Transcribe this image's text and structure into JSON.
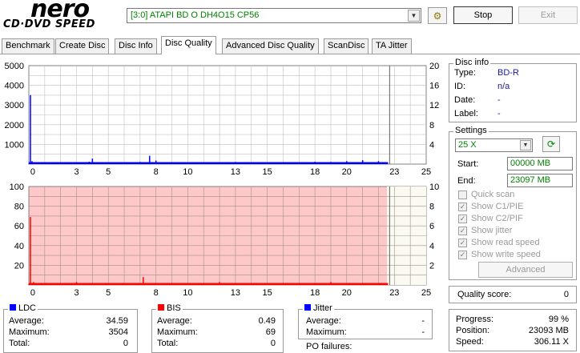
{
  "logo": {
    "main": "nero",
    "sub": "CD·DVD SPEED"
  },
  "drive": {
    "selected": "[3:0]  ATAPI BD  O  DH4O15 CP56"
  },
  "buttons": {
    "stop": "Stop",
    "exit": "Exit",
    "advanced": "Advanced"
  },
  "tabs": [
    {
      "label": "Benchmark"
    },
    {
      "label": "Create Disc"
    },
    {
      "label": "Disc Info"
    },
    {
      "label": "Disc Quality"
    },
    {
      "label": "Advanced Disc Quality"
    },
    {
      "label": "ScanDisc"
    },
    {
      "label": "TA Jitter"
    }
  ],
  "active_tab": "Disc Quality",
  "chart_data": [
    {
      "type": "line",
      "name": "LDC chart",
      "x_ticks": [
        "0",
        "3",
        "5",
        "8",
        "10",
        "13",
        "15",
        "18",
        "20",
        "23",
        "25"
      ],
      "y_left_ticks": [
        "5000",
        "4000",
        "3000",
        "2000",
        "1000"
      ],
      "y_right_ticks": [
        "20",
        "16",
        "12",
        "8",
        "4"
      ],
      "xlim": [
        0,
        25
      ],
      "ylim": [
        0,
        5000
      ],
      "series": [
        {
          "color": "#0000ff",
          "x": [
            0,
            0.1,
            0.2,
            1,
            2,
            3,
            3.8,
            4,
            5,
            6,
            7,
            7.4,
            7.6,
            8,
            9,
            10,
            11,
            12,
            13,
            14,
            15,
            16,
            17,
            18,
            19,
            20,
            20.4,
            21,
            22,
            22.5
          ],
          "y": [
            20,
            3504,
            150,
            40,
            60,
            80,
            120,
            280,
            90,
            70,
            110,
            60,
            420,
            180,
            100,
            80,
            90,
            70,
            110,
            90,
            80,
            100,
            90,
            120,
            110,
            150,
            90,
            200,
            150,
            60
          ]
        }
      ]
    },
    {
      "type": "line",
      "name": "BIS chart",
      "x_ticks": [
        "0",
        "3",
        "5",
        "8",
        "10",
        "13",
        "15",
        "18",
        "20",
        "23",
        "25"
      ],
      "y_left_ticks": [
        "100",
        "80",
        "60",
        "40",
        "20"
      ],
      "y_right_ticks": [
        "10",
        "8",
        "6",
        "4",
        "2"
      ],
      "xlim": [
        0,
        25
      ],
      "ylim": [
        0,
        100
      ],
      "series": [
        {
          "color": "#ff0000",
          "x": [
            0,
            0.1,
            0.3,
            1,
            2,
            3,
            4,
            5,
            6,
            7,
            7.2,
            8,
            9,
            10,
            11,
            12,
            13,
            14,
            15,
            16,
            17,
            18,
            19,
            20,
            21,
            22,
            22.5
          ],
          "y": [
            1,
            69,
            3,
            2,
            1,
            3,
            2,
            1,
            2,
            1,
            8,
            2,
            1,
            2,
            1,
            3,
            2,
            1,
            2,
            1,
            2,
            1,
            3,
            1,
            2,
            1,
            1
          ]
        }
      ]
    }
  ],
  "ldc": {
    "title": "LDC",
    "color": "#0000ff",
    "average_label": "Average:",
    "average": "34.59",
    "maximum_label": "Maximum:",
    "maximum": "3504",
    "total_label": "Total:",
    "total": "0"
  },
  "bis": {
    "title": "BIS",
    "color": "#ff0000",
    "average_label": "Average:",
    "average": "0.49",
    "maximum_label": "Maximum:",
    "maximum": "69",
    "total_label": "Total:",
    "total": "0"
  },
  "jitter": {
    "title": "Jitter",
    "color": "#0000ff",
    "average_label": "Average:",
    "average": "-",
    "maximum_label": "Maximum:",
    "maximum": "-",
    "po_failures_label": "PO failures:"
  },
  "disc_info": {
    "title": "Disc info",
    "type_label": "Type:",
    "type": "BD-R",
    "id_label": "ID:",
    "id": "n/a",
    "date_label": "Date:",
    "date": "-",
    "label_label": "Label:",
    "label": "-"
  },
  "settings": {
    "title": "Settings",
    "speed": "25 X",
    "start_label": "Start:",
    "start": "00000 MB",
    "end_label": "End:",
    "end": "23097 MB",
    "checks": [
      {
        "label": "Quick scan",
        "checked": false
      },
      {
        "label": "Show C1/PIE",
        "checked": true
      },
      {
        "label": "Show C2/PIF",
        "checked": true
      },
      {
        "label": "Show jitter",
        "checked": true
      },
      {
        "label": "Show read speed",
        "checked": true
      },
      {
        "label": "Show write speed",
        "checked": true
      }
    ]
  },
  "quality": {
    "label": "Quality score:",
    "value": "0"
  },
  "progress": {
    "progress_label": "Progress:",
    "progress": "99 %",
    "position_label": "Position:",
    "position": "23093 MB",
    "speed_label": "Speed:",
    "speed": "306.11 X"
  }
}
